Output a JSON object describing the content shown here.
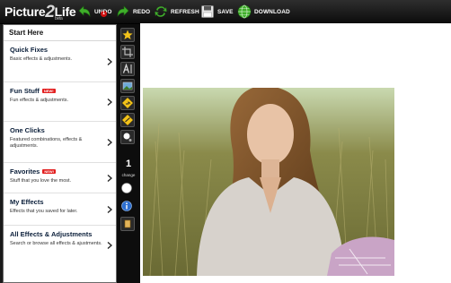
{
  "app": {
    "logo_text": "Picture",
    "logo_number": "2",
    "logo_text_2": "Life",
    "logo_beta": "beta"
  },
  "toolbar": {
    "undo_label": "UNDO",
    "undo_count": "1",
    "redo_label": "REDO",
    "refresh_label": "REFRESH",
    "save_label": "SAVE",
    "download_label": "DOWNLOAD"
  },
  "panel": {
    "title": "Start Here",
    "new_badge": "NEW!",
    "items": [
      {
        "title": "Quick Fixes",
        "desc": "Basic effects & adjustments.",
        "is_new": false
      },
      {
        "title": "Fun Stuff",
        "desc": "Fun effects & adjustments.",
        "is_new": true
      },
      {
        "title": "One Clicks",
        "desc": "Featured combinations, effects & adjustments.",
        "is_new": false
      },
      {
        "title": "Favorites",
        "desc": "Stuff that you love the most.",
        "is_new": true
      },
      {
        "title": "My Effects",
        "desc": "Effects that you saved for later.",
        "is_new": false
      },
      {
        "title": "All Effects & Adjustments",
        "desc": "Search or browse all effects & ajustments.",
        "is_new": false
      }
    ]
  },
  "side_tools": {
    "icons": [
      "star-icon",
      "crop-icon",
      "text-icon",
      "image-icon",
      "sign-icon",
      "warning-sign-icon",
      "brush-icon",
      "circle-icon",
      "info-icon",
      "bucket-icon"
    ],
    "change_count": "1",
    "change_label": "change"
  },
  "colors": {
    "toolbar_bg": "#1a1a1a",
    "panel_title_text": "#0b1f3a",
    "new_badge": "#e21f1f",
    "undo_badge": "#d01010",
    "arrow_green": "#3fae2a",
    "download_globe": "#3fae2a"
  }
}
